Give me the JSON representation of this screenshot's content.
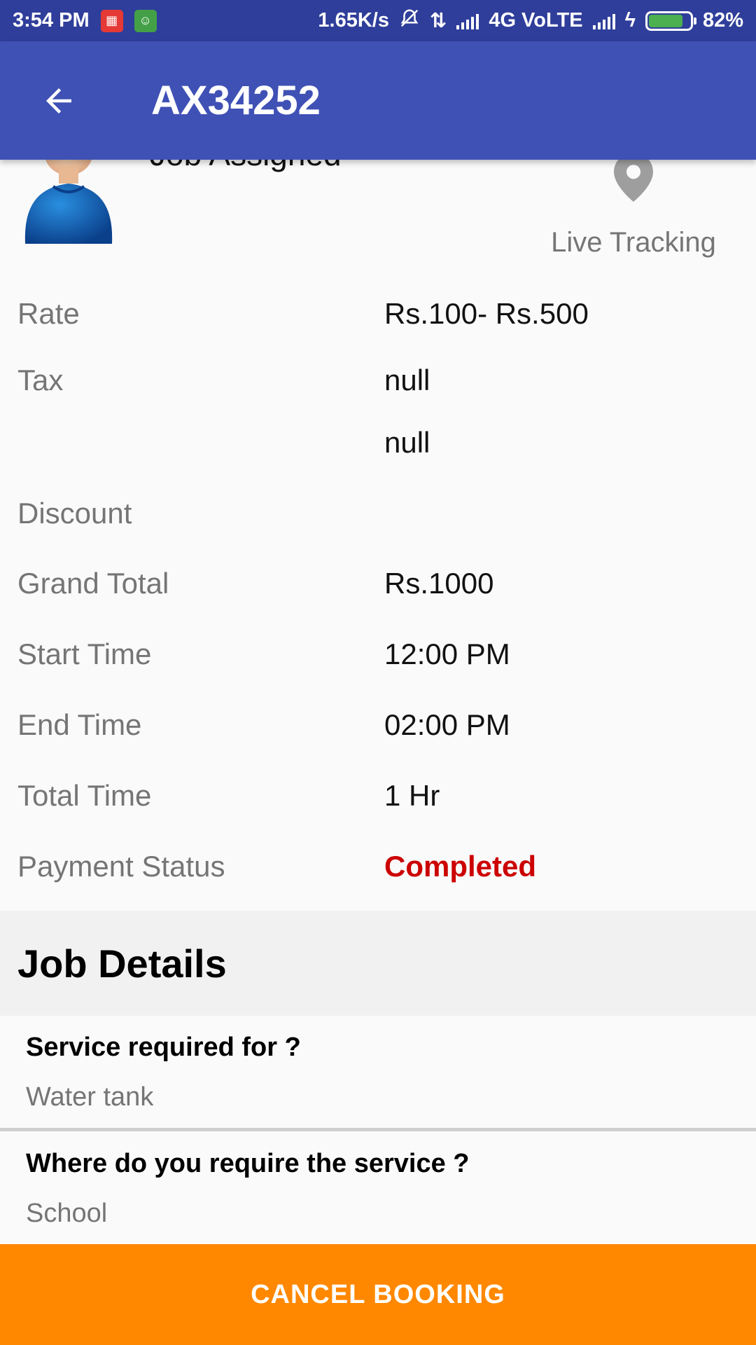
{
  "status_bar": {
    "time": "3:54 PM",
    "net_speed": "1.65K/s",
    "network": "4G VoLTE",
    "battery": "82%",
    "battery_level": 0.82
  },
  "app_bar": {
    "title": "AX34252"
  },
  "header": {
    "job_status": "Job Assigned",
    "live_tracking_label": "Live Tracking"
  },
  "details": [
    {
      "label": "Rate",
      "value": "Rs.100- Rs.500"
    },
    {
      "label": "Tax",
      "value": "null"
    },
    {
      "label": "",
      "value": "null"
    },
    {
      "label": "Discount",
      "value": ""
    },
    {
      "label": "Grand Total",
      "value": "Rs.1000"
    },
    {
      "label": "Start Time",
      "value": "12:00 PM"
    },
    {
      "label": "End Time",
      "value": "02:00 PM"
    },
    {
      "label": "Total Time",
      "value": "1 Hr"
    },
    {
      "label": "Payment Status",
      "value": "Completed"
    }
  ],
  "job_details": {
    "title": "Job Details",
    "items": [
      {
        "question": "Service required for ?",
        "answer": "Water tank"
      },
      {
        "question": "Where do you require the service ?",
        "answer": "School"
      }
    ]
  },
  "footer": {
    "cancel_label": "CANCEL BOOKING"
  },
  "colors": {
    "status_bar": "#2f3e9a",
    "app_bar": "#3f51b5",
    "accent": "#ff8800",
    "completed": "#cc0000"
  }
}
